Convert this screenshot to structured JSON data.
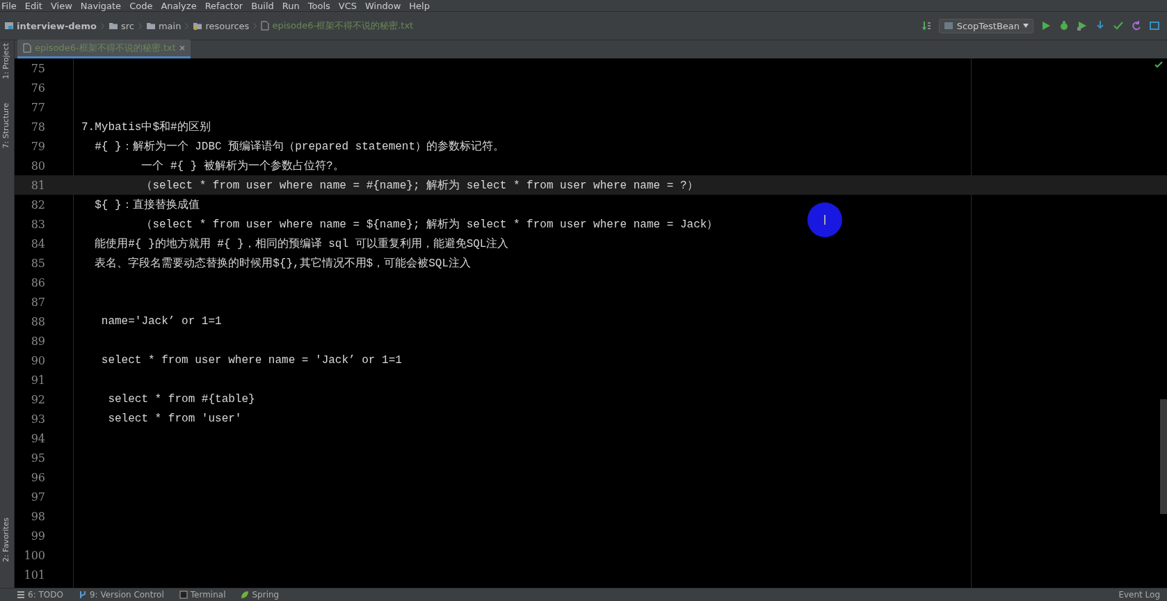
{
  "menu": [
    "File",
    "Edit",
    "View",
    "Navigate",
    "Code",
    "Analyze",
    "Refactor",
    "Build",
    "Run",
    "Tools",
    "VCS",
    "Window",
    "Help"
  ],
  "breadcrumbs": [
    {
      "label": "interview-demo",
      "kind": "project"
    },
    {
      "label": "src",
      "kind": "folder"
    },
    {
      "label": "main",
      "kind": "folder"
    },
    {
      "label": "resources",
      "kind": "resources"
    },
    {
      "label": "episode6-框架不得不说的秘密.txt",
      "kind": "file"
    }
  ],
  "run_config": "ScopTestBean",
  "tabs": [
    {
      "label": "episode6-框架不得不说的秘密.txt",
      "selected": true
    }
  ],
  "left_tools": [
    "1: Project",
    "7: Structure",
    "2: Favorites"
  ],
  "lines": [
    {
      "n": "75",
      "current": false
    },
    {
      "n": "76",
      "current": false
    },
    {
      "n": "77",
      "current": false
    },
    {
      "n": "78",
      "text": "7.Mybatis中$和#的区别",
      "current": false
    },
    {
      "n": "79",
      "text": "  #{ }：解析为一个 JDBC 预编译语句（prepared statement）的参数标记符。",
      "current": false
    },
    {
      "n": "80",
      "text": "         一个 #{ } 被解析为一个参数占位符?。",
      "current": false
    },
    {
      "n": "81",
      "text": "         （select * from user where name = #{name}; 解析为 select * from user where name = ?）",
      "current": true
    },
    {
      "n": "82",
      "text": "  ${ }：直接替换成值",
      "current": false
    },
    {
      "n": "83",
      "text": "         （select * from user where name = ${name}; 解析为 select * from user where name = Jack）",
      "current": false
    },
    {
      "n": "84",
      "text": "  能使用#{ }的地方就用 #{ }，相同的预编译 sql 可以重复利用，能避免SQL注入",
      "current": false
    },
    {
      "n": "85",
      "text": "  表名、字段名需要动态替换的时候用${},其它情况不用$，可能会被SQL注入",
      "current": false
    },
    {
      "n": "86",
      "current": false
    },
    {
      "n": "87",
      "current": false
    },
    {
      "n": "88",
      "text": "   name='Jack’ or 1=1",
      "current": false
    },
    {
      "n": "89",
      "current": false
    },
    {
      "n": "90",
      "text": "   select * from user where name = 'Jack’ or 1=1",
      "current": false
    },
    {
      "n": "91",
      "current": false
    },
    {
      "n": "92",
      "text": "    select * from #{table}",
      "current": false
    },
    {
      "n": "93",
      "text": "    select * from 'user'",
      "current": false
    },
    {
      "n": "94",
      "current": false
    },
    {
      "n": "95",
      "current": false
    },
    {
      "n": "96",
      "current": false
    },
    {
      "n": "97",
      "current": false
    },
    {
      "n": "98",
      "current": false
    },
    {
      "n": "99",
      "current": false
    },
    {
      "n": "100",
      "current": false
    },
    {
      "n": "101",
      "current": false
    }
  ],
  "bottom_tools": [
    {
      "label": "6: TODO",
      "kind": "todo"
    },
    {
      "label": "9: Version Control",
      "kind": "vcs"
    },
    {
      "label": "Terminal",
      "kind": "terminal"
    },
    {
      "label": "Spring",
      "kind": "spring"
    }
  ],
  "event_log": "Event Log"
}
